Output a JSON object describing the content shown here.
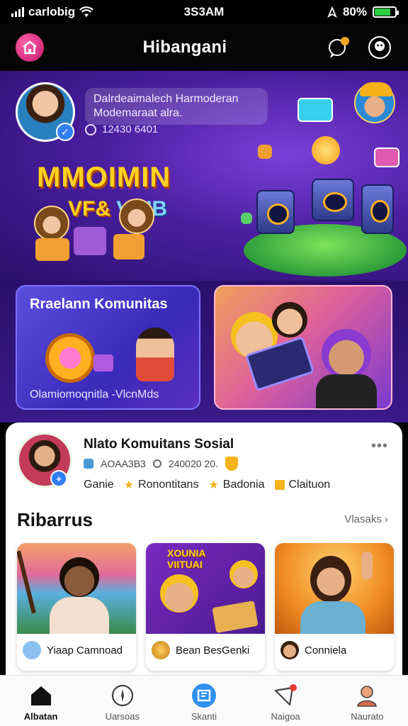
{
  "status_bar": {
    "carrier": "carlobig",
    "time": "3S3AM",
    "battery": "80%",
    "battery_level": 0.8,
    "battery_color": "#2ecc40"
  },
  "header": {
    "title": "Hibangani",
    "home_icon": "home-icon",
    "actions": [
      "chat-icon",
      "profile-icon"
    ],
    "accent": "#e0257f"
  },
  "hero": {
    "message_line1": "Dalrdeaimalech Harmoderan",
    "message_line2": "Modemaraat alra.",
    "stat": "12430 6401",
    "title_line1": "MMOIMIN",
    "title_line2_a": "VF&",
    "title_line2_b": "VIUB",
    "background": "#4b1fa0"
  },
  "features": {
    "left_title": "Rraelann Komunitas",
    "left_subtitle": "Olamiomoqnitla -VlcnMds",
    "right_label": ""
  },
  "post": {
    "title": "Nlato Komuitans Sosial",
    "meta_id": "AOAA3B3",
    "meta_time": "240020 20.",
    "tags": [
      "Ganie",
      "Ronontitans",
      "Badonia",
      "Claituon"
    ],
    "more": "•••"
  },
  "section": {
    "title": "Ribarrus",
    "link": "Vlasaks"
  },
  "cards": [
    {
      "label": "Yiaap Camnoad"
    },
    {
      "label": "Bean BesGenki",
      "image_text_1": "XOUNIA",
      "image_text_2": "VIITUAI"
    },
    {
      "label": "Conniela"
    }
  ],
  "tabbar": {
    "items": [
      {
        "label": "Albatan",
        "icon": "home-icon",
        "active": true
      },
      {
        "label": "Uarsoas",
        "icon": "compass-icon",
        "active": false
      },
      {
        "label": "Skanti",
        "icon": "scan-icon",
        "active": false
      },
      {
        "label": "Naigoa",
        "icon": "notification-icon",
        "active": false
      },
      {
        "label": "Naurato",
        "icon": "profile-icon",
        "active": false
      }
    ]
  }
}
